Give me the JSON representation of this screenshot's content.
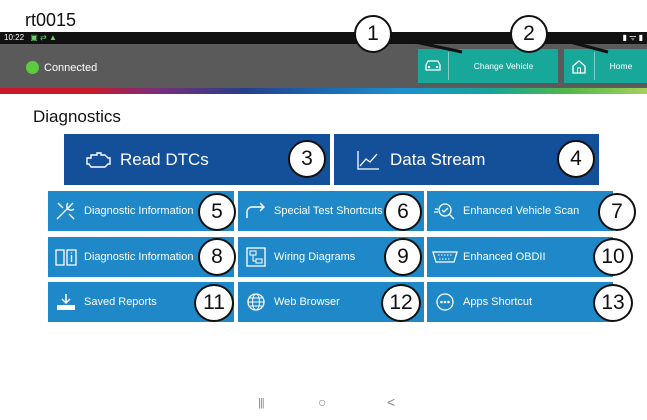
{
  "doc_label": "rt0015",
  "statusbar": {
    "time": "10:22",
    "icons_right": "▮ ᯤ ▮"
  },
  "appbar": {
    "status": "Connected",
    "change_vehicle": "Change Vehicle",
    "home": "Home"
  },
  "page_title": "Diagnostics",
  "big_buttons": {
    "read_dtcs": "Read DTCs",
    "data_stream": "Data Stream"
  },
  "grid": {
    "r1c1": "Diagnostic Information",
    "r1c2": "Special Test Shortcuts",
    "r1c3": "Enhanced Vehicle Scan",
    "r2c1": "Diagnostic Information",
    "r2c2": "Wiring Diagrams",
    "r2c3": "Enhanced OBDII",
    "r3c1": "Saved Reports",
    "r3c2": "Web Browser",
    "r3c3": "Apps Shortcut"
  },
  "callouts": [
    "1",
    "2",
    "3",
    "4",
    "5",
    "6",
    "7",
    "8",
    "9",
    "10",
    "11",
    "12",
    "13"
  ],
  "navbar": {
    "recents": "|||",
    "home": "○",
    "back": "<"
  },
  "colors": {
    "appbar": "#5a5a5a",
    "teal_button": "#17a89a",
    "big_button": "#14509a",
    "grid_button": "#1f88c9",
    "connected": "#5ccc3e"
  }
}
